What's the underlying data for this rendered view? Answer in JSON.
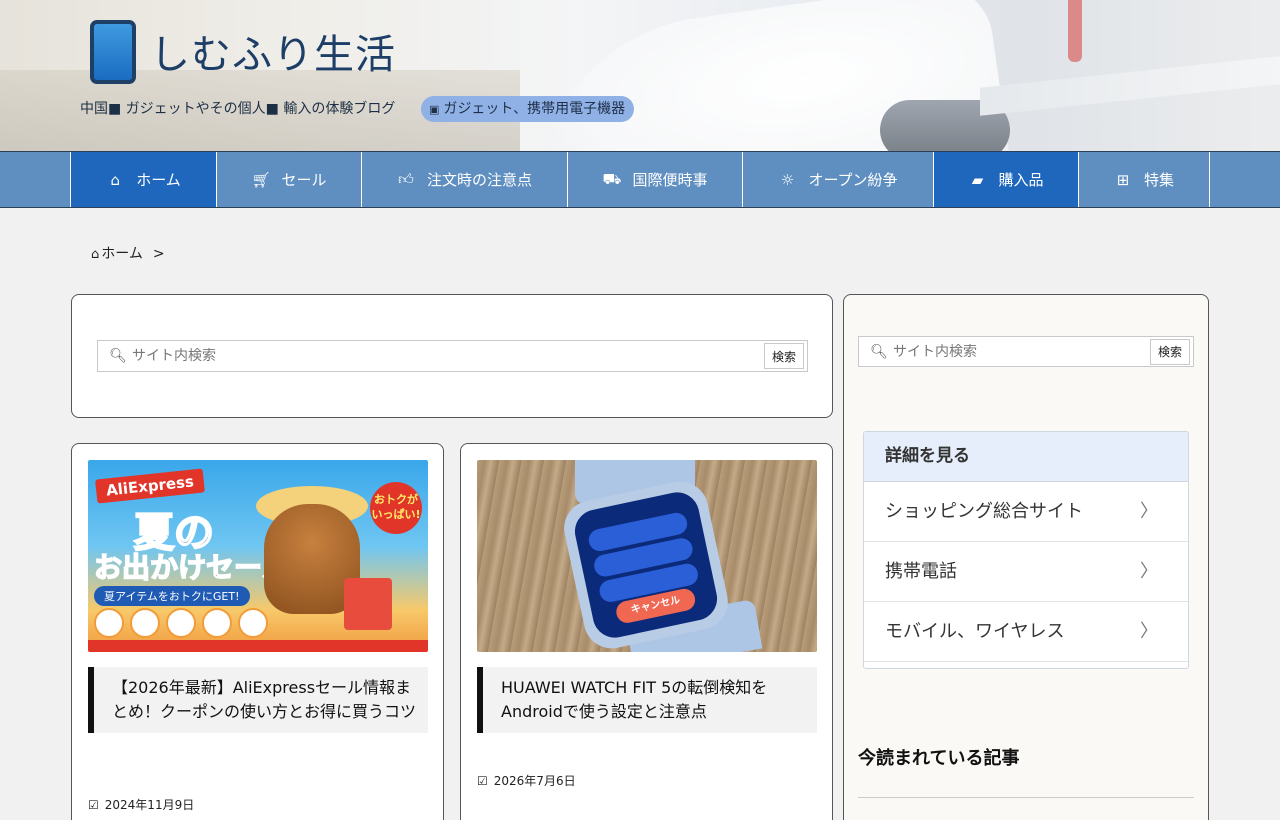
{
  "header": {
    "site_title": "しむふり生活",
    "tagline": "中国■ ガジェットやその個人■ 輸入の体験ブログ",
    "tag_chip": "ガジェット、携帯用電子機器",
    "tag_chip_icon": "image-icon"
  },
  "nav": {
    "items": [
      {
        "label": "ホーム",
        "icon": "home-icon",
        "glyph": "⌂"
      },
      {
        "label": "セール",
        "icon": "cart-icon",
        "glyph": "🛒"
      },
      {
        "label": "注文時の注意点",
        "icon": "thumbs-up-icon",
        "glyph": "👍"
      },
      {
        "label": "国際便時事",
        "icon": "truck-icon",
        "glyph": "🚚"
      },
      {
        "label": "オープン紛争",
        "icon": "lightbulb-icon",
        "glyph": "💡"
      },
      {
        "label": "購入品",
        "icon": "briefcase-icon",
        "glyph": "💼"
      },
      {
        "label": "特集",
        "icon": "gift-icon",
        "glyph": "🎁"
      }
    ],
    "active_color": "#1e67bd",
    "bar_color": "#5f8fc0"
  },
  "breadcrumb": {
    "home": "ホーム",
    "separator": ">"
  },
  "main_search": {
    "placeholder": "サイト内検索",
    "button": "検索"
  },
  "cards": [
    {
      "title": "【2026年最新】AliExpressセール情報まとめ！クーポンの使い方とお得に買うコツ",
      "date": "2024年11月9日",
      "thumb": {
        "brand": "AliExpress",
        "headline1": "夏の",
        "headline2": "お出かけセール",
        "strip": "夏アイテムをおトクにGET!",
        "badge": "おトクがいっぱい!"
      }
    },
    {
      "title": "HUAWEI WATCH FIT 5の転倒検知をAndroidで使う設定と注意点",
      "date": "2026年7月6日",
      "thumb": {
        "cancel_label": "キャンセル"
      }
    }
  ],
  "sidebar": {
    "search": {
      "placeholder": "サイト内検索",
      "button": "検索"
    },
    "menu_title": "詳細を見る",
    "menu_items": [
      "ショッピング総合サイト",
      "携帯電話",
      "モバイル、ワイヤレス"
    ],
    "popular_title": "今読まれている記事"
  }
}
